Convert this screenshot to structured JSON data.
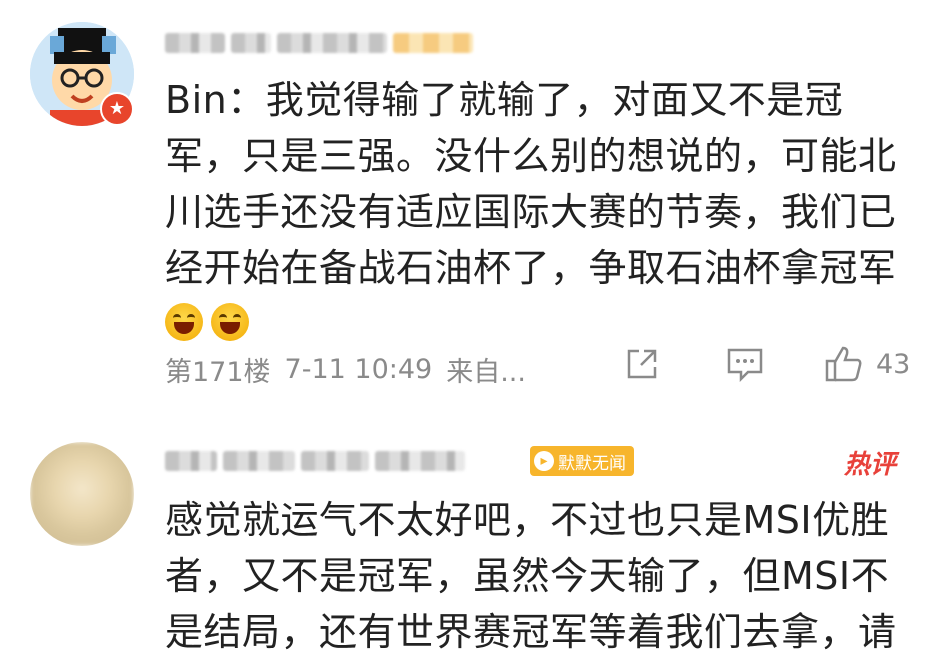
{
  "comments": [
    {
      "body": "Bin：我觉得输了就输了，对面又不是冠军，只是三强。没什么别的想说的，可能北川选手还没有适应国际大赛的节奏，我们已经开始在备战石油杯了，争取石油杯拿冠军",
      "line1": "Bin：我觉得输了就输了，对面又不是冠",
      "line2": "军，只是三强。没什么别的想说的，可能北",
      "line3": "川选手还没有适应国际大赛的节奏，我们已",
      "line4": "经开始在备战石油杯了，争取石油杯拿冠军",
      "floor": "第171楼",
      "time": "7-11 10:49",
      "source": "来自...",
      "likes": "43"
    },
    {
      "badge": "默默无闻",
      "hot_tag": "热评",
      "line1": "感觉就运气不太好吧，不过也只是MSI优胜",
      "line2": "者，又不是冠军，虽然今天输了，但MSI不",
      "line3": "是结局，还有世界赛冠军等着我们去拿，请"
    }
  ],
  "icons": {
    "share": "share-icon",
    "reply": "comment-icon",
    "like": "thumbs-up-icon",
    "emoji": "laughing-emoji-icon",
    "badge": "level-badge-icon"
  },
  "colors": {
    "meta_text": "#8a8a8a",
    "badge_bg": "#f7b52c",
    "hot_tag": "#e8413a"
  }
}
